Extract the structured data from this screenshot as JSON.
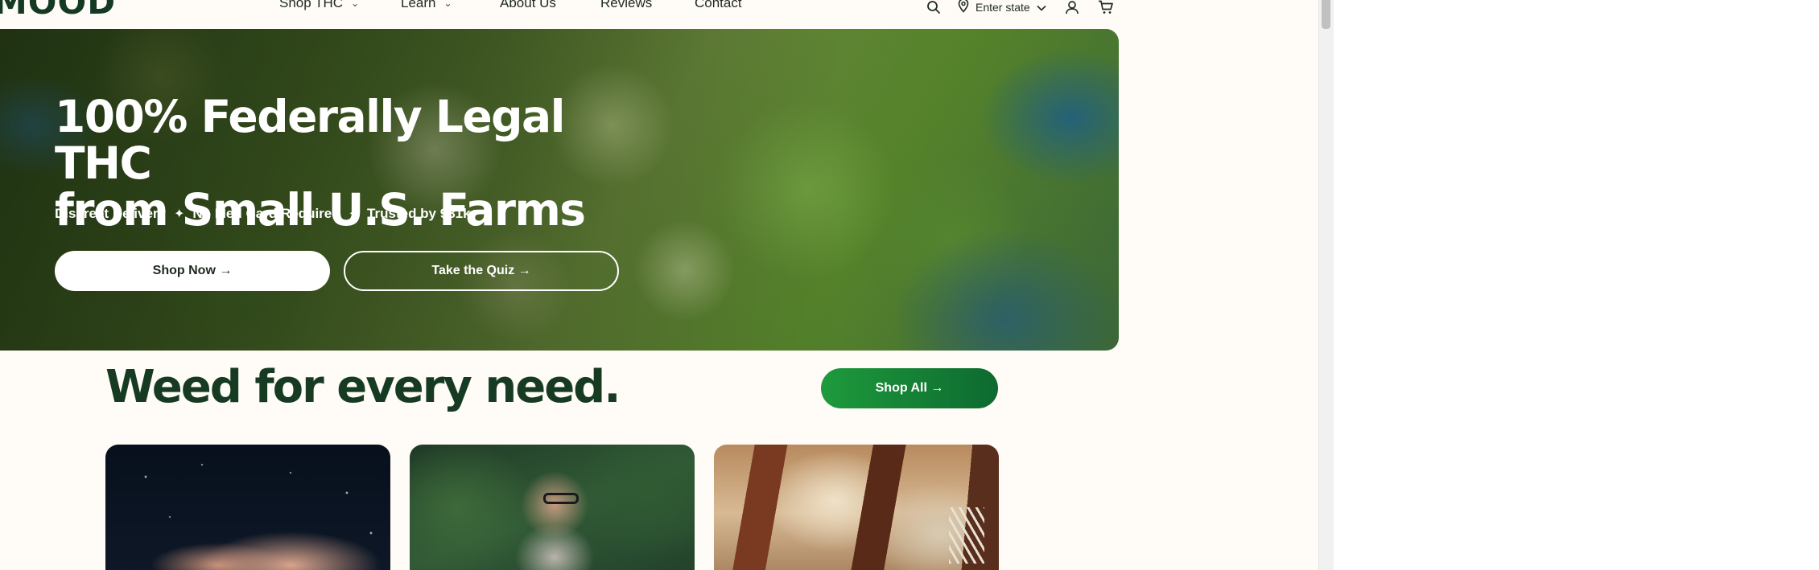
{
  "header": {
    "logo": "MOOD",
    "nav": [
      {
        "label": "Shop THC",
        "has_dropdown": true
      },
      {
        "label": "Learn",
        "has_dropdown": true
      },
      {
        "label": "About Us",
        "has_dropdown": false
      },
      {
        "label": "Reviews",
        "has_dropdown": false
      },
      {
        "label": "Contact",
        "has_dropdown": false
      }
    ],
    "state_selector": "Enter state",
    "icons": [
      "search-icon",
      "location-pin-icon",
      "chevron-down-icon",
      "account-icon",
      "cart-icon"
    ]
  },
  "hero": {
    "title_line1": "100% Federally Legal THC",
    "title_line2": "from Small U.S. Farms",
    "features": [
      "Discreet Delivery",
      "No Med Card Required",
      "Trusted by 981k+"
    ],
    "separator": "✦",
    "shop_now_label": "Shop Now →",
    "quiz_label": "Take the Quiz →"
  },
  "collection": {
    "title": "Weed for every need.",
    "shop_all_label": "Shop All →",
    "cards": [
      "card-night-sky-person",
      "card-man-glasses-forest",
      "card-hammock-trees"
    ]
  },
  "colors": {
    "page_background": "#fffbf6",
    "brand_dark_green": "#173b22",
    "accent_green_start": "#1e9a3c",
    "accent_green_end": "#0d6a30"
  }
}
